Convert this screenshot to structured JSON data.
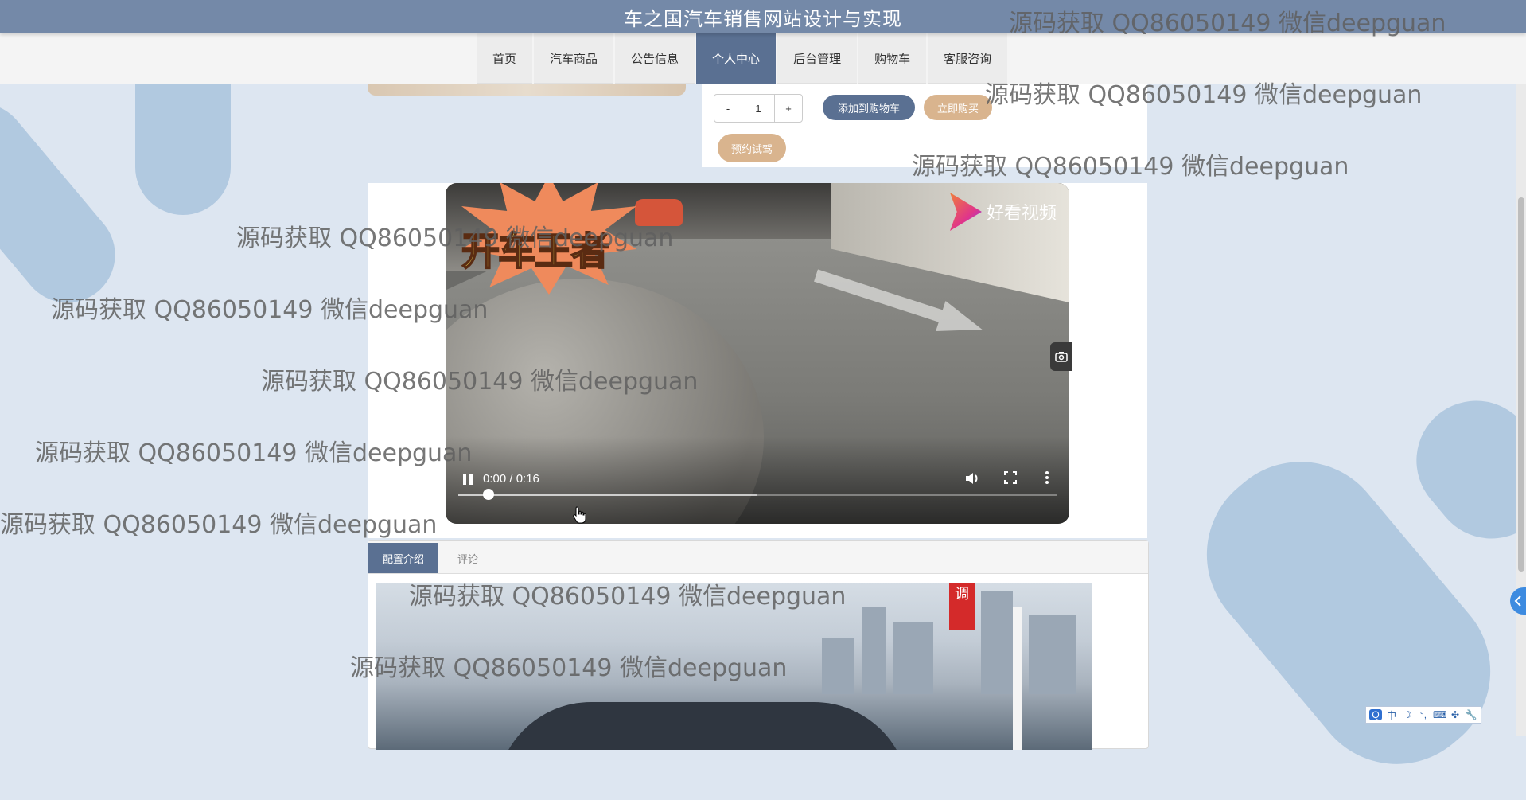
{
  "header": {
    "title": "车之国汽车销售网站设计与实现"
  },
  "nav": {
    "items": [
      "首页",
      "汽车商品",
      "公告信息",
      "个人中心",
      "后台管理",
      "购物车",
      "客服咨询"
    ],
    "active": "个人中心"
  },
  "product": {
    "qty_minus": "-",
    "qty_value": "1",
    "qty_plus": "+",
    "add_to_cart": "添加到购物车",
    "buy_now": "立即购买",
    "book_test_drive": "预约试驾"
  },
  "video": {
    "burst_text": "开车王者",
    "logo_text": "好看视频",
    "time": "0:00 / 0:16",
    "progress": 0.05,
    "buffered": 0.5
  },
  "tabs": {
    "items": [
      "配置介绍",
      "评论"
    ],
    "active": "配置介绍",
    "photo_sign": "调"
  },
  "ime": {
    "items": [
      "Q",
      "中",
      "☽",
      "°,",
      "⌨",
      "✣",
      "🔧"
    ]
  },
  "watermark": {
    "text": "源码获取 QQ86050149 微信deepguan"
  },
  "icons": {
    "play_pause": "pause-icon",
    "volume": "volume-icon",
    "fullscreen": "fullscreen-icon",
    "more": "more-vert-icon",
    "camera": "camera-icon",
    "side_tab": "chevron-left-icon"
  },
  "colors": {
    "header": "#7489a8",
    "nav_active": "#5a7092",
    "accent_blue": "#5a7092",
    "accent_tan": "#d9b48e",
    "background": "#dde6f1"
  }
}
